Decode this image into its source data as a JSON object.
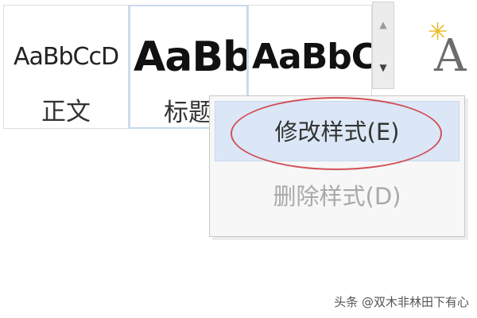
{
  "ribbon": {
    "styles": [
      {
        "preview": "AaBbCcD",
        "name": "正文"
      },
      {
        "preview": "AaBb",
        "name": "标题"
      },
      {
        "preview": "AaBbC",
        "name": ""
      }
    ],
    "change_styles": {
      "preview": "A",
      "icon": "sparkle-icon"
    },
    "scroll": {
      "up_icon": "▲",
      "down_icon": "▼"
    }
  },
  "context_menu": {
    "items": [
      {
        "label": "修改样式(E)",
        "state": "hover"
      },
      {
        "label": "删除样式(D)",
        "state": "disabled"
      }
    ]
  },
  "annotation": {
    "color": "#d34f57"
  },
  "watermark": "头条 @双木非林田下有心",
  "colors": {
    "menu_hover": "#dbe7f6",
    "menu_background": "#f7f7f7",
    "disabled_text": "#a9a9a9"
  }
}
